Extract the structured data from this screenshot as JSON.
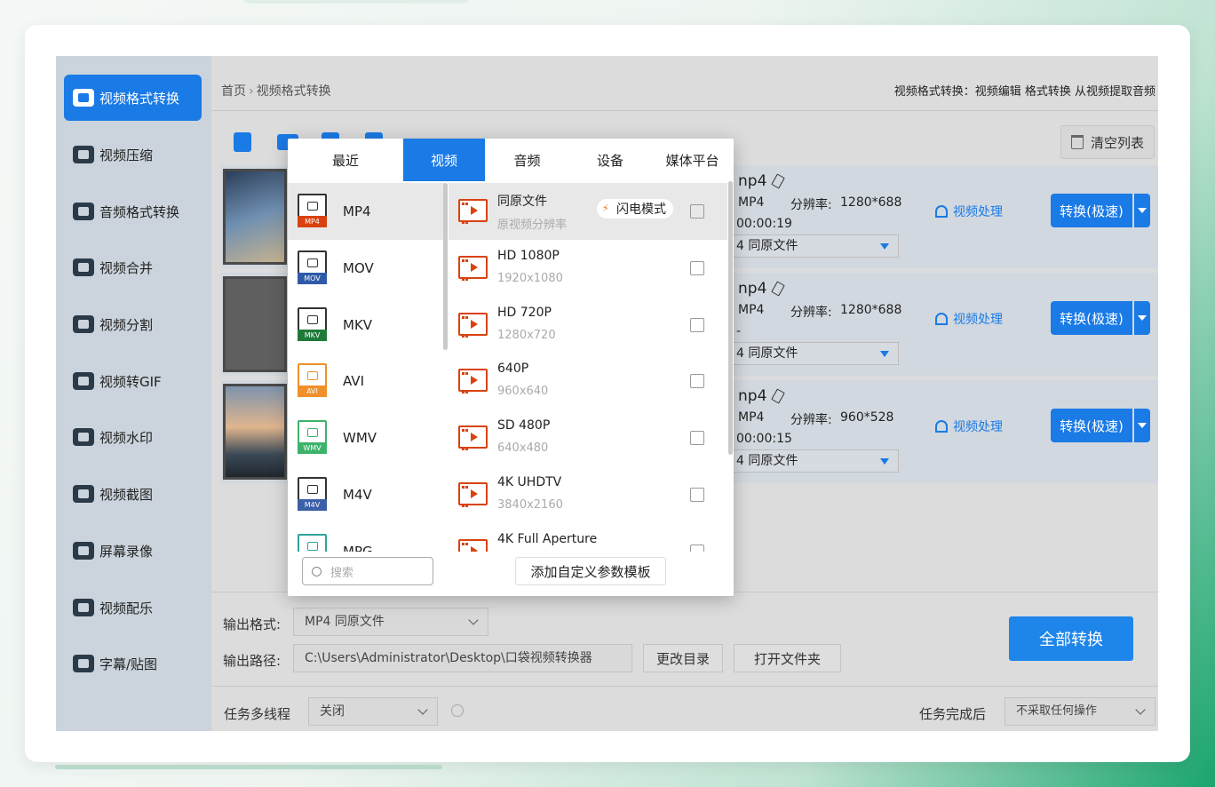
{
  "sidebar": {
    "items": [
      {
        "label": "视频格式转换",
        "icon": "video-convert-icon"
      },
      {
        "label": "视频压缩",
        "icon": "video-compress-icon"
      },
      {
        "label": "音频格式转换",
        "icon": "audio-convert-icon"
      },
      {
        "label": "视频合并",
        "icon": "video-merge-icon"
      },
      {
        "label": "视频分割",
        "icon": "video-split-icon"
      },
      {
        "label": "视频转GIF",
        "icon": "video-gif-icon"
      },
      {
        "label": "视频水印",
        "icon": "video-watermark-icon"
      },
      {
        "label": "视频截图",
        "icon": "video-screenshot-icon"
      },
      {
        "label": "屏幕录像",
        "icon": "screen-record-icon"
      },
      {
        "label": "视频配乐",
        "icon": "video-music-icon"
      },
      {
        "label": "字幕/贴图",
        "icon": "subtitle-icon"
      }
    ]
  },
  "header": {
    "breadcrumb_home": "首页",
    "breadcrumb_sep": "›",
    "breadcrumb_current": "视频格式转换",
    "right_text": "视频格式转换：视频编辑 格式转换 从视频提取音频"
  },
  "toolbar": {
    "clear_label": "清空列表"
  },
  "files": [
    {
      "name": "np4",
      "format": "MP4",
      "res_label": "分辨率:",
      "resolution": "1280*688",
      "duration": "00:00:19",
      "output": "4  同原文件",
      "process": "视频处理",
      "convert": "转换(极速)"
    },
    {
      "name": "np4",
      "format": "MP4",
      "res_label": "分辨率:",
      "resolution": "1280*688",
      "duration": "-",
      "output": "4  同原文件",
      "process": "视频处理",
      "convert": "转换(极速)"
    },
    {
      "name": "np4",
      "format": "MP4",
      "res_label": "分辨率:",
      "resolution": "960*528",
      "duration": "00:00:15",
      "output": "4  同原文件",
      "process": "视频处理",
      "convert": "转换(极速)"
    }
  ],
  "bottom": {
    "output_format_label": "输出格式:",
    "output_format_value": "MP4  同原文件",
    "output_path_label": "输出路径:",
    "output_path_value": "C:\\Users\\Administrator\\Desktop\\口袋视频转换器",
    "change_dir": "更改目录",
    "open_folder": "打开文件夹",
    "convert_all": "全部转换",
    "multithread_label": "任务多线程",
    "multithread_value": "关闭",
    "after_done_label": "任务完成后",
    "after_done_value": "不采取任何操作"
  },
  "popup": {
    "tabs": [
      "最近",
      "视频",
      "音频",
      "设备",
      "媒体平台"
    ],
    "active_tab": "视频",
    "formats": [
      {
        "name": "MP4",
        "tag": "MP4",
        "color": "#d9420f"
      },
      {
        "name": "MOV",
        "tag": "MOV",
        "color": "#2f5aa8"
      },
      {
        "name": "MKV",
        "tag": "MKV",
        "color": "#1f7a3a"
      },
      {
        "name": "AVI",
        "tag": "AVI",
        "color": "#f0902a"
      },
      {
        "name": "WMV",
        "tag": "WMV",
        "color": "#3cb36a"
      },
      {
        "name": "M4V",
        "tag": "M4V",
        "color": "#3b5fa8"
      },
      {
        "name": "MPG",
        "tag": "",
        "color": "#2aa59a"
      }
    ],
    "presets": [
      {
        "name": "同原文件",
        "sub": "原视频分辨率"
      },
      {
        "name": "HD 1080P",
        "sub": "1920x1080"
      },
      {
        "name": "HD 720P",
        "sub": "1280x720"
      },
      {
        "name": "640P",
        "sub": "960x640"
      },
      {
        "name": "SD 480P",
        "sub": "640x480"
      },
      {
        "name": "4K UHDTV",
        "sub": "3840x2160"
      },
      {
        "name": "4K Full Aperture",
        "sub": ""
      }
    ],
    "flash_mode": "闪电模式",
    "search_placeholder": "搜索",
    "add_template": "添加自定义参数模板"
  }
}
